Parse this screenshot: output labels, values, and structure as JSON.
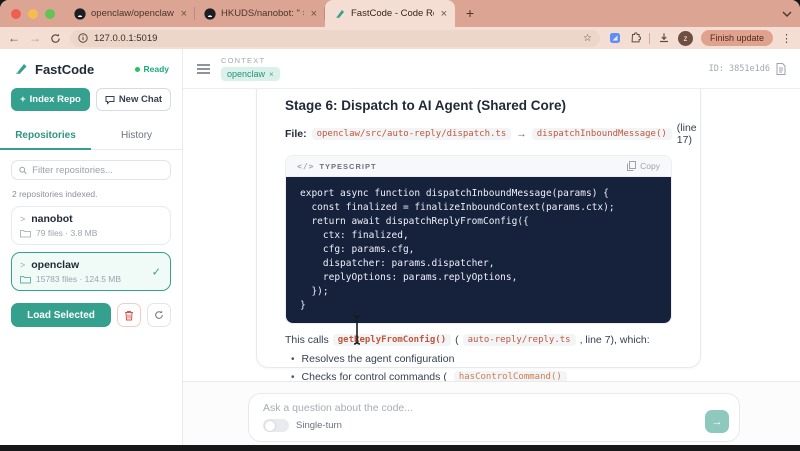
{
  "browser": {
    "tabs": [
      {
        "title": "openclaw/openclaw: Your ow"
      },
      {
        "title": "HKUDS/nanobot: \" = nanob"
      },
      {
        "title": "FastCode - Code Repository"
      }
    ],
    "tab_close_glyph": "×",
    "new_tab_glyph": "+",
    "back_glyph": "←",
    "forward_glyph": "→",
    "url": "127.0.0.1:5019",
    "star_glyph": "☆",
    "avatar_letter": "z",
    "finish_update_label": "Finish update",
    "kebab_glyph": "⋮"
  },
  "sidebar": {
    "brand": "FastCode",
    "status": "Ready",
    "index_repo_label": "Index Repo",
    "plus_glyph": "+",
    "new_chat_label": "New Chat",
    "tabs": {
      "repositories": "Repositories",
      "history": "History"
    },
    "filter_placeholder": "Filter repositories...",
    "indexed_count": "2 repositories indexed.",
    "repos": [
      {
        "name": "nanobot",
        "meta": "79 files · 3.8 MB",
        "selected": false
      },
      {
        "name": "openclaw",
        "meta": "15783 files · 124.5 MB",
        "selected": true
      }
    ],
    "caret_glyph": ">",
    "check_glyph": "✓",
    "load_selected_label": "Load Selected"
  },
  "main": {
    "context_label": "CONTEXT",
    "context_chip": "openclaw",
    "chip_close_glyph": "×",
    "session_id": "ID: 3851e1d6",
    "heading": "Stage 6: Dispatch to AI Agent (Shared Core)",
    "file_label": "File:",
    "file_path": "openclaw/src/auto-reply/dispatch.ts",
    "arrow_glyph": "→",
    "file_func": "dispatchInboundMessage()",
    "line_ref": "(line 17)",
    "code_lang_label": "TYPESCRIPT",
    "code_icon_glyph": "</>",
    "copy_label": "Copy",
    "code_lines": [
      "export async function dispatchInboundMessage(params) {",
      "  const finalized = finalizeInboundContext(params.ctx);",
      "  return await dispatchReplyFromConfig({",
      "    ctx: finalized,",
      "    cfg: params.cfg,",
      "    dispatcher: params.dispatcher,",
      "    replyOptions: params.replyOptions,",
      "  });",
      "}"
    ],
    "calls_prefix": "This calls",
    "calls_func": "getReplyFromConfig()",
    "calls_open": "(",
    "calls_file": "auto-reply/reply.ts",
    "calls_suffix": ", line 7), which:",
    "bullet_glyph": "•",
    "bullets": [
      "Resolves the agent configuration",
      "Checks for control commands ("
    ],
    "bullet2_chip": "hasControlCommand()"
  },
  "composer": {
    "placeholder": "Ask a question about the code...",
    "toggle_label": "Single-turn",
    "send_glyph": "→"
  },
  "colors": {
    "accent_teal": "#35a08d",
    "status_green": "#22c55e",
    "code_block_bg": "#16213c",
    "inline_code_text": "#c0583c",
    "tabbar_salmon": "#dca493",
    "active_tab": "#f4ded3"
  }
}
